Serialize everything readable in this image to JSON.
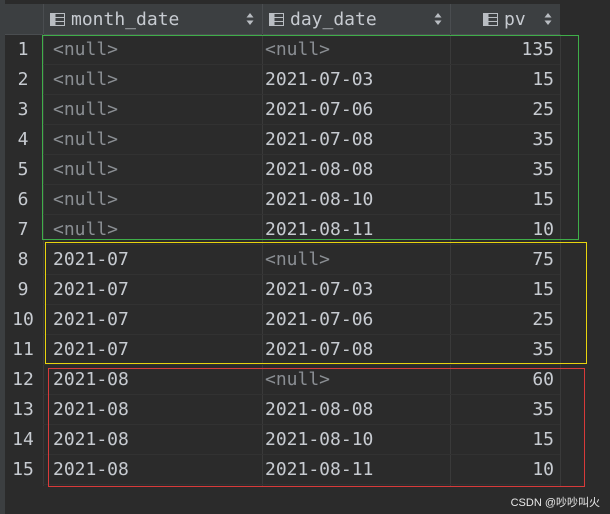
{
  "columns": [
    {
      "label": "month_date",
      "icon": "table-column-icon"
    },
    {
      "label": "day_date",
      "icon": "table-column-icon"
    },
    {
      "label": "pv",
      "icon": "table-column-icon"
    }
  ],
  "rows": [
    {
      "num": "1",
      "month_date": "<null>",
      "day_date": "<null>",
      "pv": "135"
    },
    {
      "num": "2",
      "month_date": "<null>",
      "day_date": "2021-07-03",
      "pv": "15"
    },
    {
      "num": "3",
      "month_date": "<null>",
      "day_date": "2021-07-06",
      "pv": "25"
    },
    {
      "num": "4",
      "month_date": "<null>",
      "day_date": "2021-07-08",
      "pv": "35"
    },
    {
      "num": "5",
      "month_date": "<null>",
      "day_date": "2021-08-08",
      "pv": "35"
    },
    {
      "num": "6",
      "month_date": "<null>",
      "day_date": "2021-08-10",
      "pv": "15"
    },
    {
      "num": "7",
      "month_date": "<null>",
      "day_date": "2021-08-11",
      "pv": "10"
    },
    {
      "num": "8",
      "month_date": "2021-07",
      "day_date": "<null>",
      "pv": "75"
    },
    {
      "num": "9",
      "month_date": "2021-07",
      "day_date": "2021-07-03",
      "pv": "15"
    },
    {
      "num": "10",
      "month_date": "2021-07",
      "day_date": "2021-07-06",
      "pv": "25"
    },
    {
      "num": "11",
      "month_date": "2021-07",
      "day_date": "2021-07-08",
      "pv": "35"
    },
    {
      "num": "12",
      "month_date": "2021-08",
      "day_date": "<null>",
      "pv": "60"
    },
    {
      "num": "13",
      "month_date": "2021-08",
      "day_date": "2021-08-08",
      "pv": "35"
    },
    {
      "num": "14",
      "month_date": "2021-08",
      "day_date": "2021-08-10",
      "pv": "15"
    },
    {
      "num": "15",
      "month_date": "2021-08",
      "day_date": "2021-08-11",
      "pv": "10"
    }
  ],
  "watermark": "CSDN @吵吵叫火",
  "colors": {
    "highlight_group_1": "#3fae49",
    "highlight_group_2": "#e8d40e",
    "highlight_group_3": "#d83a3a",
    "null_text": "#8a8e93"
  }
}
